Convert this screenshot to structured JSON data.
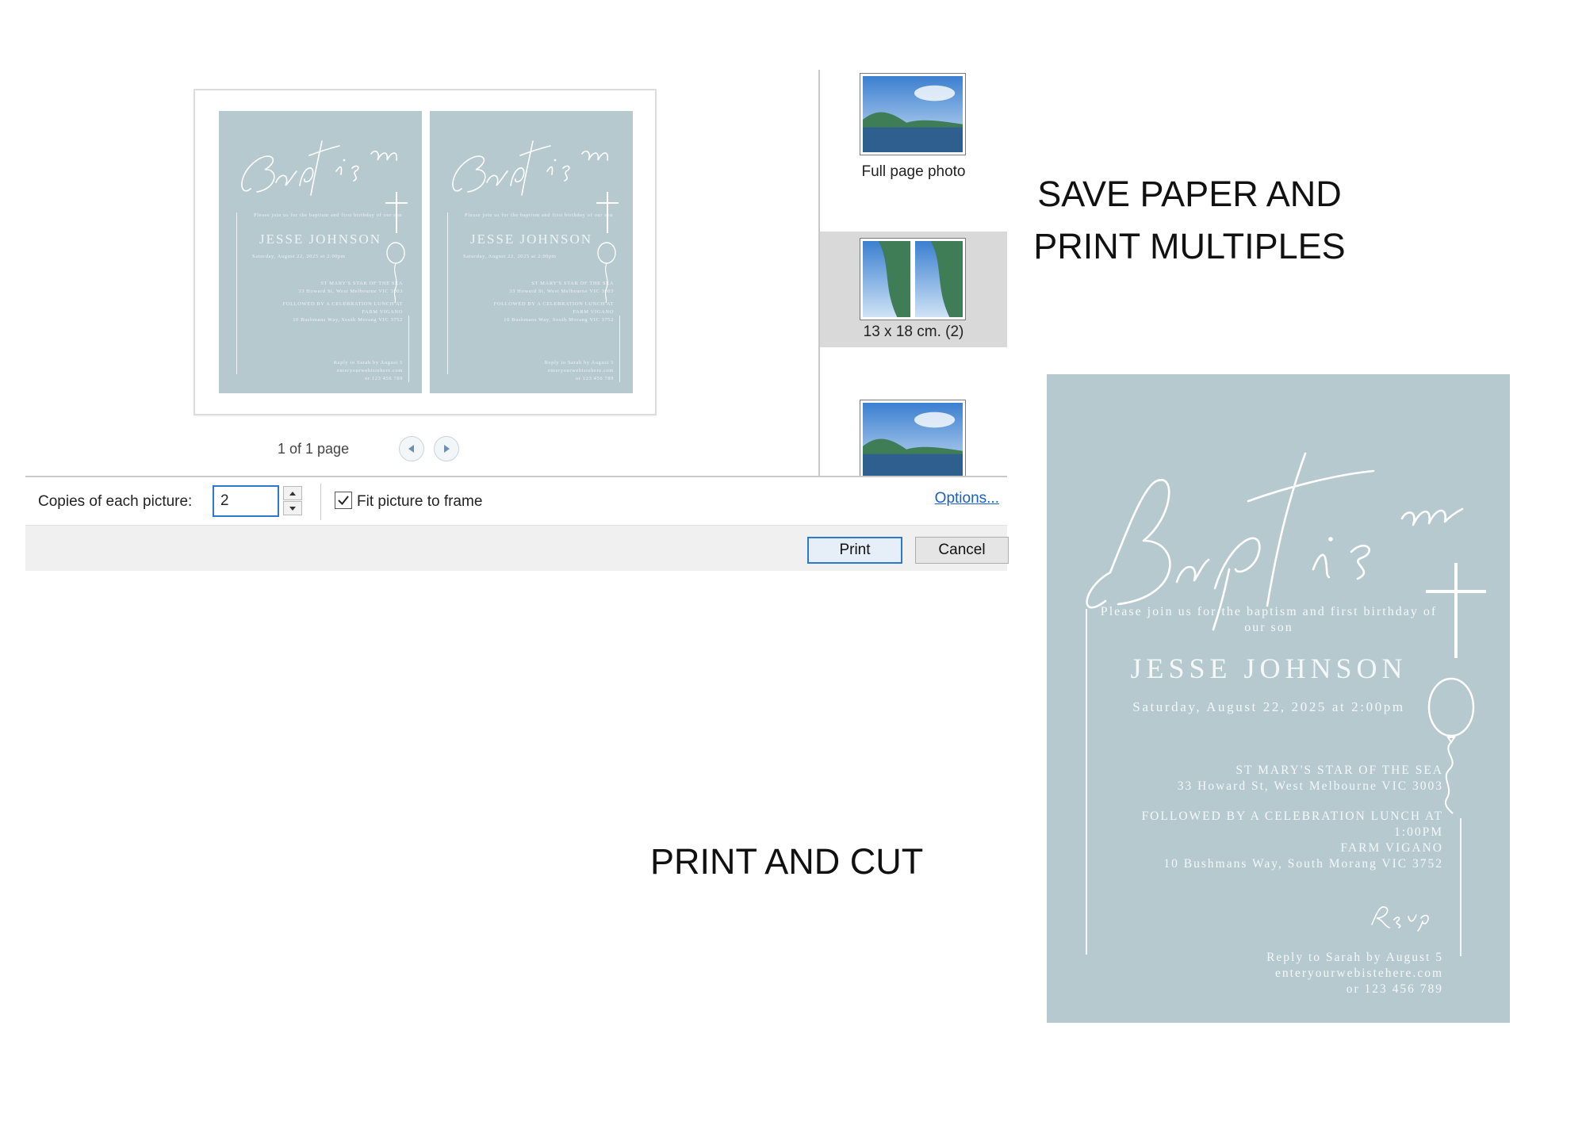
{
  "dialog": {
    "page_counter": "1 of 1 page",
    "layouts": [
      {
        "label": "Full page photo",
        "selected": false
      },
      {
        "label": "13 x 18 cm. (2)",
        "selected": true
      },
      {
        "label": "",
        "selected": false
      }
    ],
    "copies_label": "Copies of each picture:",
    "copies_value": "2",
    "fit_checked": true,
    "fit_label": "Fit picture to frame",
    "options_link": "Options...",
    "print_label": "Print",
    "cancel_label": "Cancel"
  },
  "headlines": {
    "save_line1": "SAVE PAPER AND",
    "save_line2": "PRINT MULTIPLES",
    "print_cut": "PRINT AND CUT"
  },
  "invitation": {
    "title_script": "Baptism",
    "invite_line": "Please join us for the baptism and first birthday of our son",
    "name": "JESSE JOHNSON",
    "date": "Saturday, August 22, 2025 at 2:00pm",
    "church": "ST MARY'S STAR OF THE SEA",
    "address": "33 Howard St, West Melbourne VIC 3003",
    "followed": "FOLLOWED BY A CELEBRATION LUNCH AT",
    "time": "1:00PM",
    "venue": "FARM VIGANO",
    "venue_address": "10 Bushmans Way, South Morang VIC 3752",
    "rsvp_script": "Rsvp",
    "reply": "Reply to Sarah by August 5",
    "website": "enteryourwebistehere.com",
    "phone": "or 123 456 789"
  },
  "colors": {
    "card_blue": "#b6c9cf",
    "dialog_accent": "#2b79d3",
    "link_blue": "#1b5fc1"
  }
}
